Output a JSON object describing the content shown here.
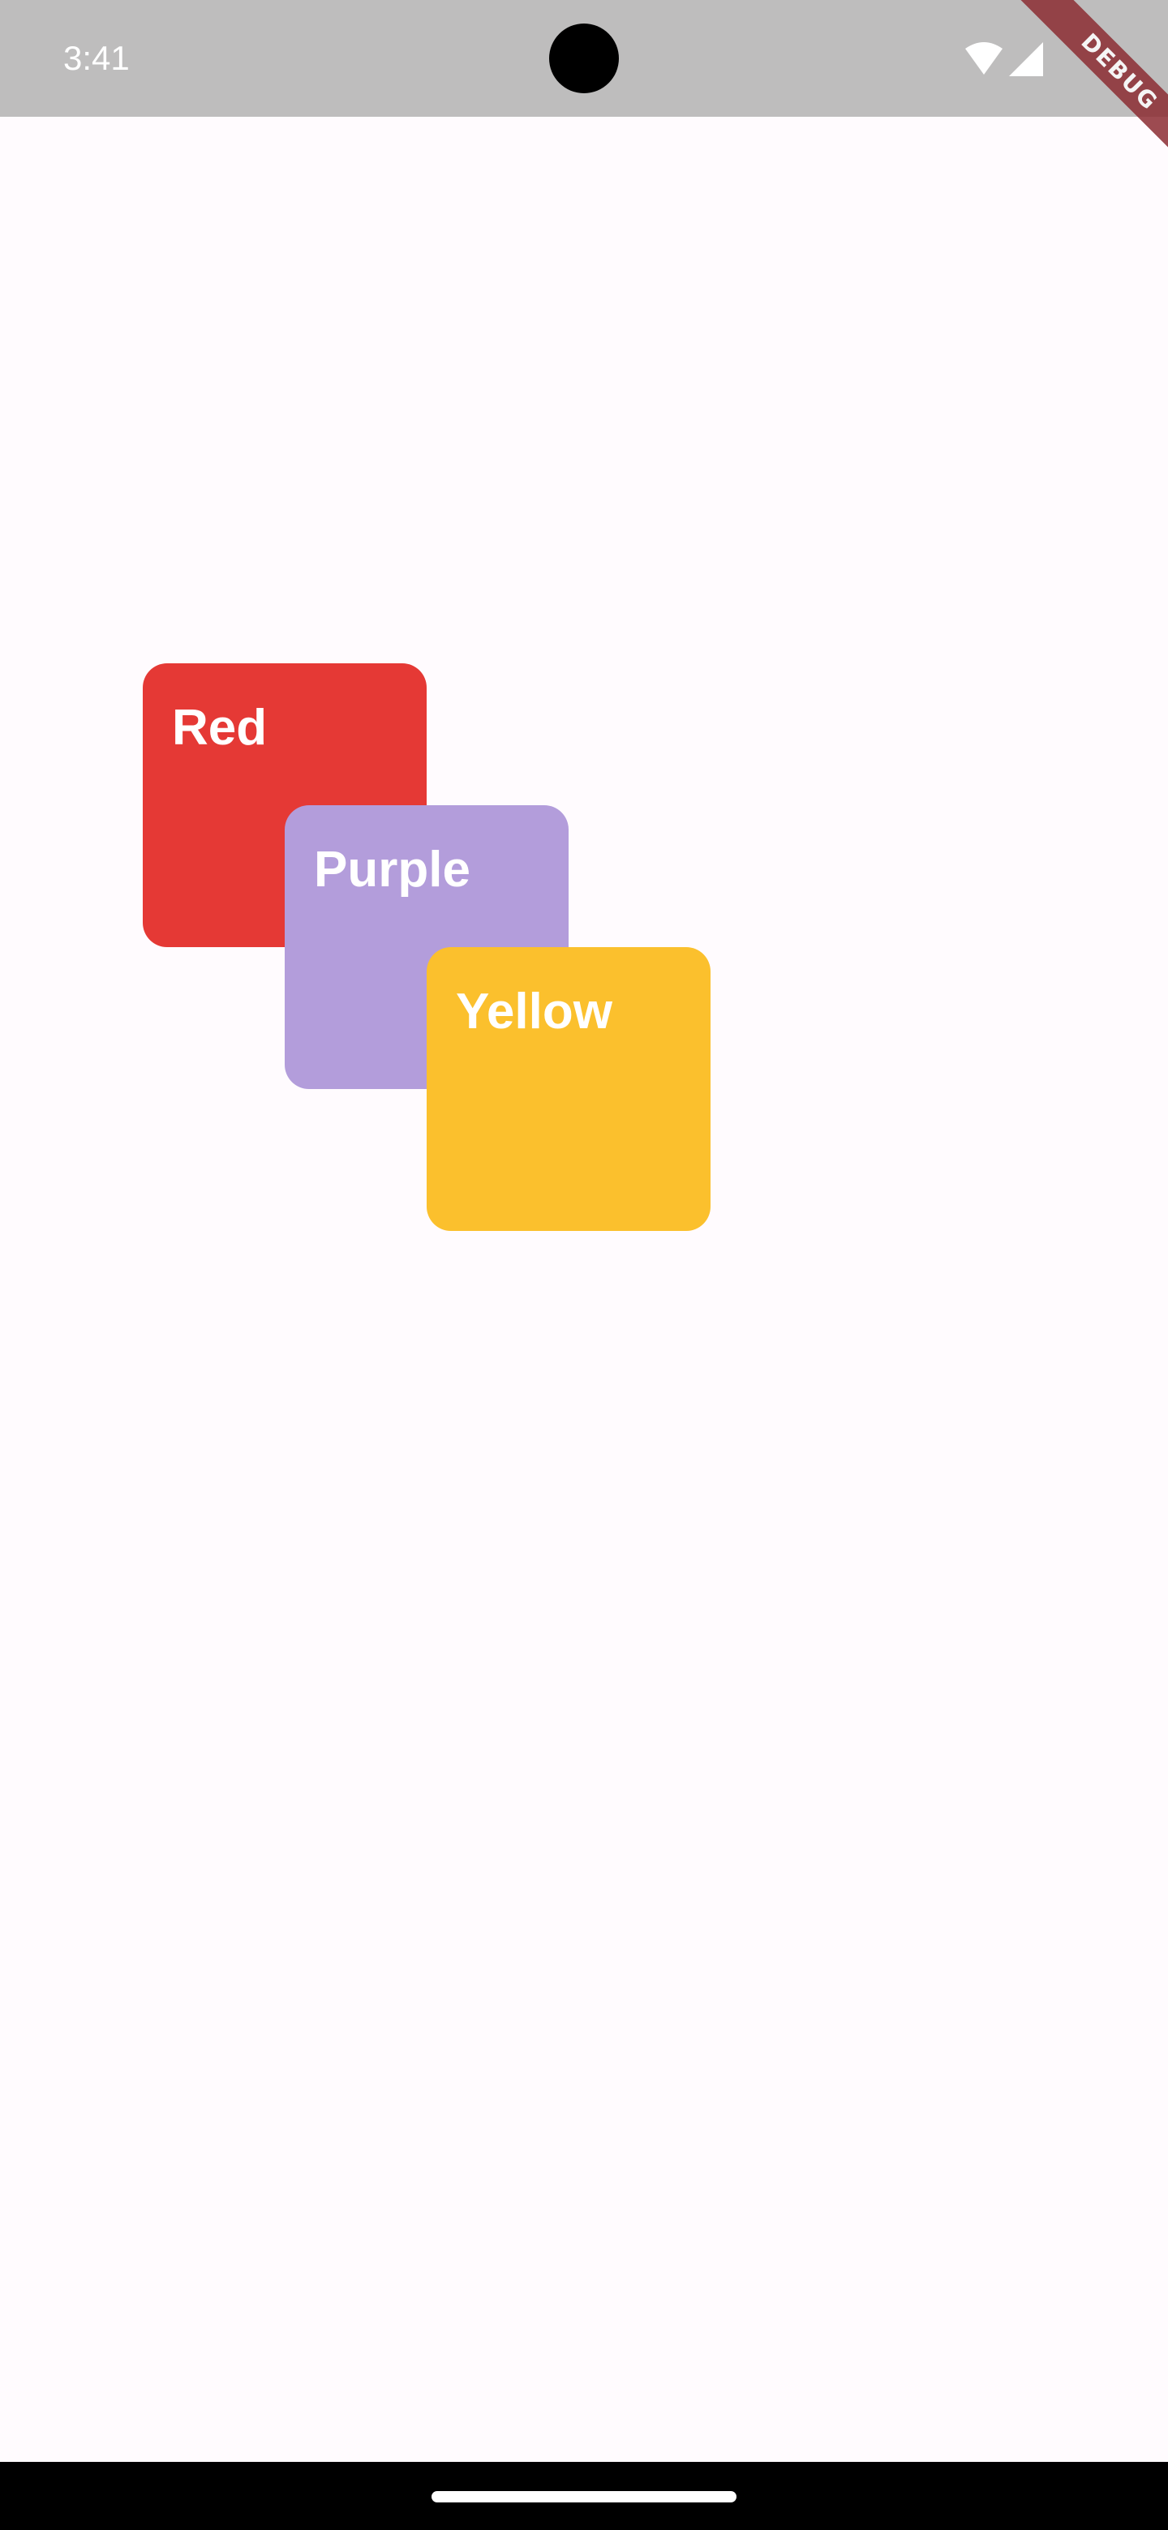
{
  "status_bar": {
    "time": "3:41",
    "icons": [
      "wifi-icon",
      "cellular-signal-icon"
    ],
    "background": "#bebdbd"
  },
  "debug_banner": {
    "label": "DEBUG",
    "color": "#8c2d33"
  },
  "page": {
    "background": "#fffbfe"
  },
  "boxes": [
    {
      "label": "Red",
      "color": "#e53935"
    },
    {
      "label": "Purple",
      "color": "#b39ddb"
    },
    {
      "label": "Yellow",
      "color": "#fbc02d"
    }
  ],
  "nav_bar": {
    "background": "#000000",
    "handle_color": "#ffffff"
  }
}
